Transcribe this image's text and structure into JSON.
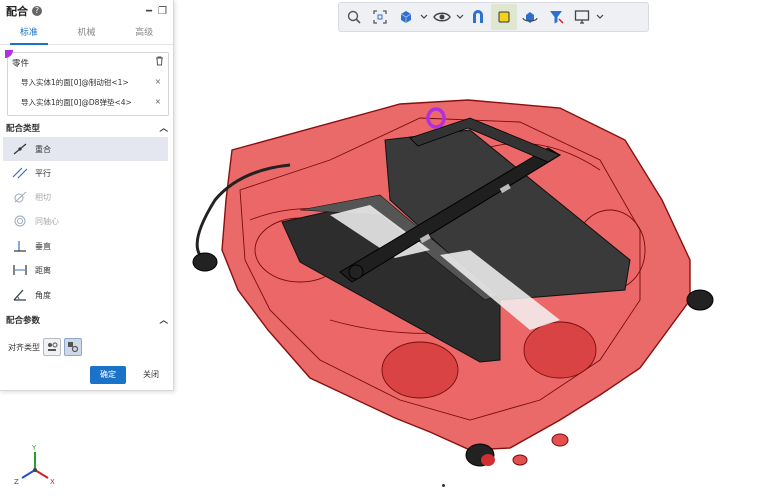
{
  "panel": {
    "title": "配合",
    "help": "?",
    "tabs": [
      "标准",
      "机械",
      "高级"
    ],
    "parts": {
      "label": "零件",
      "items": [
        "导入实体1的面[0]@制动钳<1>",
        "导入实体1的面[0]@D8弹垫<4>"
      ],
      "remove": "×"
    },
    "mate_type_label": "配合类型",
    "mate_types": [
      {
        "label": "重合",
        "icon": "coincident-icon",
        "selected": true
      },
      {
        "label": "平行",
        "icon": "parallel-icon"
      },
      {
        "label": "相切",
        "icon": "tangent-icon",
        "disabled": true
      },
      {
        "label": "同轴心",
        "icon": "concentric-icon",
        "disabled": true
      },
      {
        "label": "垂直",
        "icon": "perpendicular-icon"
      },
      {
        "label": "距离",
        "icon": "distance-icon"
      },
      {
        "label": "角度",
        "icon": "angle-icon"
      }
    ],
    "params_label": "配合参数",
    "align_label": "对齐类型",
    "ok": "确定",
    "cancel": "关闭"
  },
  "toolbar": {
    "icons": [
      "zoom-icon",
      "fit-view-icon",
      "view-cube-icon",
      "visibility-eye-icon",
      "section-view-icon",
      "appearance-icon",
      "rotate-view-icon",
      "filter-icon",
      "display-monitor-icon"
    ]
  },
  "triad": {
    "x": "X",
    "y": "Y",
    "z": "Z"
  },
  "colors": {
    "accent": "#1a73c8",
    "body": "#e02020",
    "pad": "#2a2a2a",
    "selection": "#b030e0"
  }
}
